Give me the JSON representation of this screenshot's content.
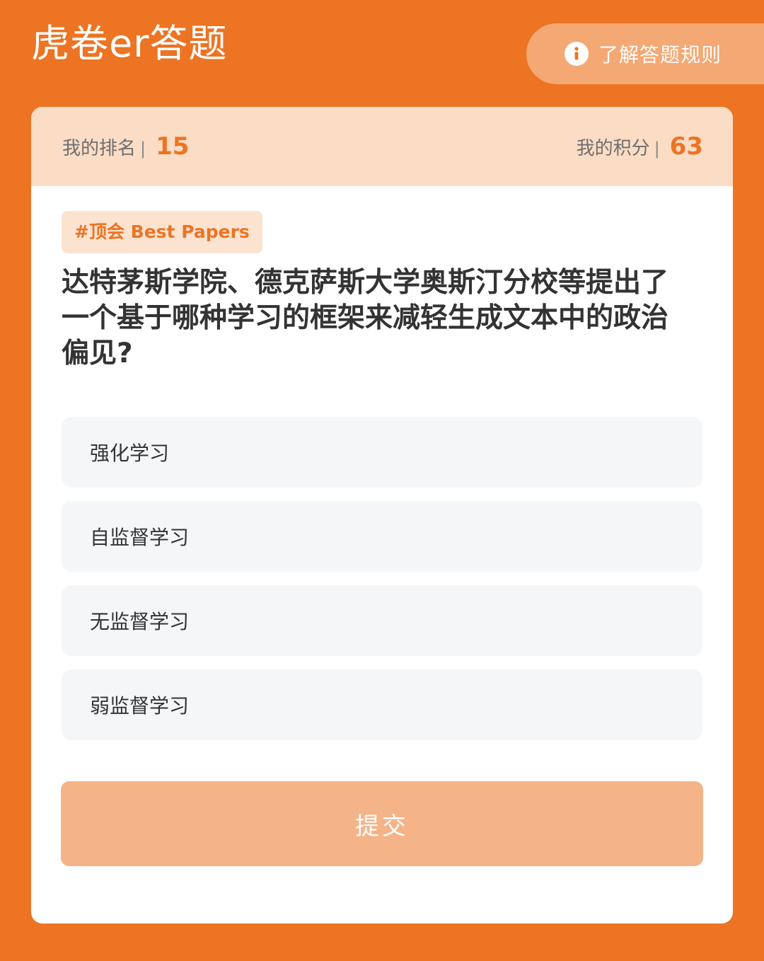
{
  "header": {
    "title": "虎卷er答题",
    "rules_label": "了解答题规则",
    "rules_icon": "info-icon"
  },
  "stats": {
    "rank_label": "我的排名",
    "separator": "|",
    "rank_value": "15",
    "score_label": "我的积分",
    "score_value": "63"
  },
  "quiz": {
    "tag": "#顶会 Best Papers",
    "question": "达特茅斯学院、德克萨斯大学奥斯汀分校等提出了一个基于哪种学习的框架来减轻生成文本中的政治偏见?",
    "options": [
      "强化学习",
      "自监督学习",
      "无监督学习",
      "弱监督学习"
    ],
    "submit_label": "提交"
  },
  "colors": {
    "background": "#EC7423",
    "accent": "#EC7423",
    "stats_bar": "#FBDCC5",
    "submit_disabled": "#F5B388"
  }
}
